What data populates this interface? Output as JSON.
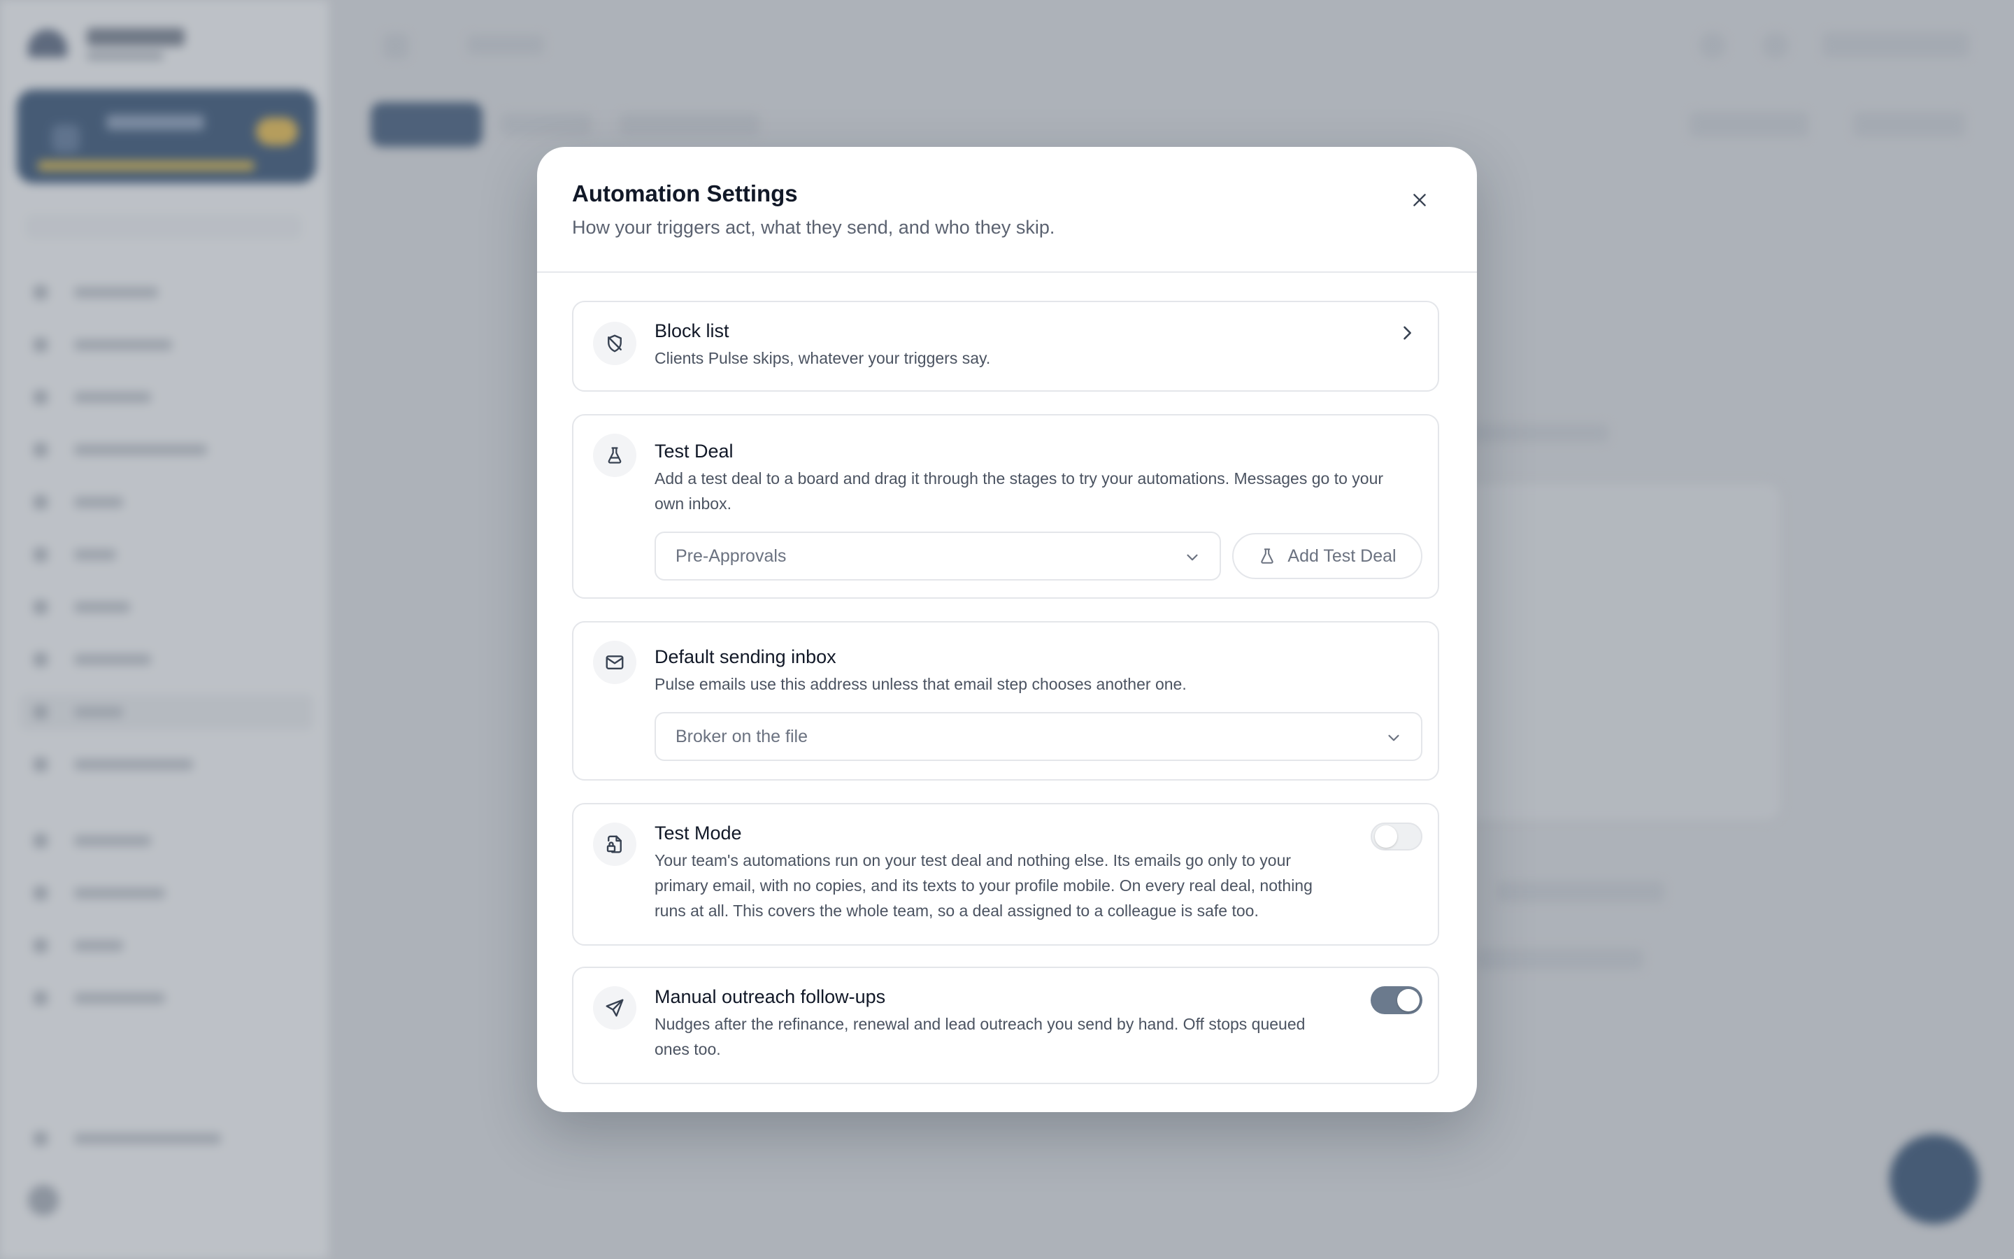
{
  "modal": {
    "title": "Automation Settings",
    "subtitle": "How your triggers act, what they send, and who they skip.",
    "close_icon": "close-icon"
  },
  "block_list": {
    "icon": "shield-off-icon",
    "title": "Block list",
    "description": "Clients Pulse skips, whatever your triggers say."
  },
  "test_deal": {
    "icon": "flask-icon",
    "title": "Test Deal",
    "description": "Add a test deal to a board and drag it through the stages to try your automations. Messages go to your own inbox.",
    "board_select_value": "Pre-Approvals",
    "add_button_label": "Add Test Deal"
  },
  "default_inbox": {
    "icon": "mail-icon",
    "title": "Default sending inbox",
    "description": "Pulse emails use this address unless that email step chooses another one.",
    "select_value": "Broker on the file"
  },
  "test_mode": {
    "icon": "file-lock-icon",
    "title": "Test Mode",
    "description": "Your team's automations run on your test deal and nothing else. Its emails go only to your primary email, with no copies, and its texts to your profile mobile. On every real deal, nothing runs at all. This covers the whole team, so a deal assigned to a colleague is safe too.",
    "enabled": false
  },
  "manual_outreach": {
    "icon": "send-icon",
    "title": "Manual outreach follow-ups",
    "description": "Nudges after the refinance, renewal and lead outreach you send by hand. Off stops queued ones too.",
    "enabled": true
  },
  "colors": {
    "brand_navy": "#0e2f57",
    "toggle_on": "#6b7a8d",
    "accent_gold": "#d8a72a"
  }
}
